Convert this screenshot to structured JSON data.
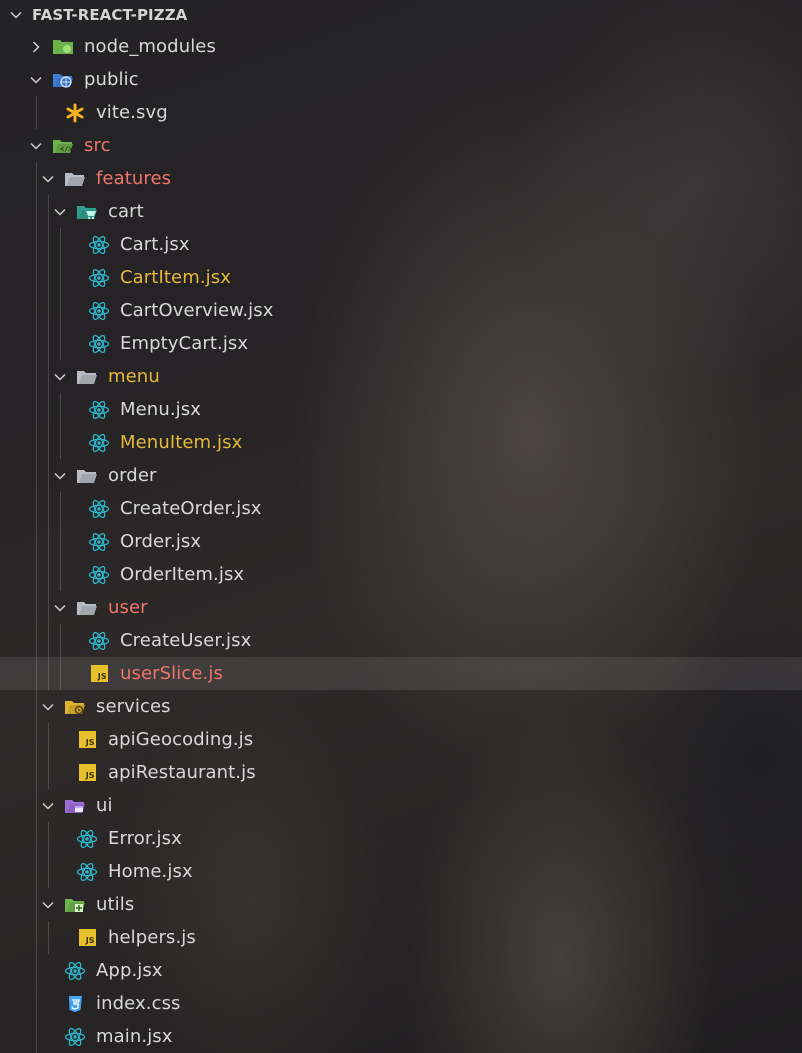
{
  "explorer": {
    "root": "FAST-REACT-PIZZA",
    "rows": [
      {
        "label": "node_modules",
        "kind": "folder-node",
        "depth": 1,
        "chev": "right",
        "color": "white"
      },
      {
        "label": "public",
        "kind": "folder-public",
        "depth": 1,
        "chev": "down",
        "color": "white"
      },
      {
        "label": "vite.svg",
        "kind": "file-svg",
        "depth": 2,
        "color": "white"
      },
      {
        "label": "src",
        "kind": "folder-src",
        "depth": 1,
        "chev": "down",
        "color": "red"
      },
      {
        "label": "features",
        "kind": "folder-open",
        "depth": 2,
        "chev": "down",
        "color": "red"
      },
      {
        "label": "cart",
        "kind": "folder-cart",
        "depth": 3,
        "chev": "down",
        "color": "yellow-white"
      },
      {
        "label": "Cart.jsx",
        "kind": "file-react",
        "depth": 4,
        "color": "white"
      },
      {
        "label": "CartItem.jsx",
        "kind": "file-react",
        "depth": 4,
        "color": "yellow"
      },
      {
        "label": "CartOverview.jsx",
        "kind": "file-react",
        "depth": 4,
        "color": "white"
      },
      {
        "label": "EmptyCart.jsx",
        "kind": "file-react",
        "depth": 4,
        "color": "white"
      },
      {
        "label": "menu",
        "kind": "folder-open",
        "depth": 3,
        "chev": "down",
        "color": "yellow"
      },
      {
        "label": "Menu.jsx",
        "kind": "file-react",
        "depth": 4,
        "color": "white"
      },
      {
        "label": "MenuItem.jsx",
        "kind": "file-react",
        "depth": 4,
        "color": "yellow"
      },
      {
        "label": "order",
        "kind": "folder-open",
        "depth": 3,
        "chev": "down",
        "color": "white"
      },
      {
        "label": "CreateOrder.jsx",
        "kind": "file-react",
        "depth": 4,
        "color": "white"
      },
      {
        "label": "Order.jsx",
        "kind": "file-react",
        "depth": 4,
        "color": "white"
      },
      {
        "label": "OrderItem.jsx",
        "kind": "file-react",
        "depth": 4,
        "color": "white"
      },
      {
        "label": "user",
        "kind": "folder-open",
        "depth": 3,
        "chev": "down",
        "color": "red"
      },
      {
        "label": "CreateUser.jsx",
        "kind": "file-react",
        "depth": 4,
        "color": "white"
      },
      {
        "label": "userSlice.js",
        "kind": "file-js",
        "depth": 4,
        "color": "red",
        "highlight": true
      },
      {
        "label": "services",
        "kind": "folder-services",
        "depth": 2,
        "chev": "down",
        "color": "white"
      },
      {
        "label": "apiGeocoding.js",
        "kind": "file-js",
        "depth": 3,
        "color": "white"
      },
      {
        "label": "apiRestaurant.js",
        "kind": "file-js",
        "depth": 3,
        "color": "white"
      },
      {
        "label": "ui",
        "kind": "folder-ui",
        "depth": 2,
        "chev": "down",
        "color": "white"
      },
      {
        "label": "Error.jsx",
        "kind": "file-react",
        "depth": 3,
        "color": "white"
      },
      {
        "label": "Home.jsx",
        "kind": "file-react",
        "depth": 3,
        "color": "white"
      },
      {
        "label": "utils",
        "kind": "folder-utils",
        "depth": 2,
        "chev": "down",
        "color": "white"
      },
      {
        "label": "helpers.js",
        "kind": "file-js",
        "depth": 3,
        "color": "white"
      },
      {
        "label": "App.jsx",
        "kind": "file-react",
        "depth": 2,
        "color": "white"
      },
      {
        "label": "index.css",
        "kind": "file-css",
        "depth": 2,
        "color": "white"
      },
      {
        "label": "main.jsx",
        "kind": "file-react",
        "depth": 2,
        "color": "white"
      }
    ]
  },
  "icons": {
    "react": "react-icon",
    "js_badge_text": "JS",
    "css": "css-icon",
    "svg": "vite-svg-icon"
  },
  "colors": {
    "red": "#f0756b",
    "yellow": "#e6b83a",
    "white": "#d8d8d8",
    "react": "#2bb6c9",
    "js": "#e8c02d",
    "folder_green": "#6cb24b",
    "folder_blue": "#3d7fd8",
    "folder_grey": "#b8bcc4",
    "folder_purple": "#9b6bd8"
  }
}
